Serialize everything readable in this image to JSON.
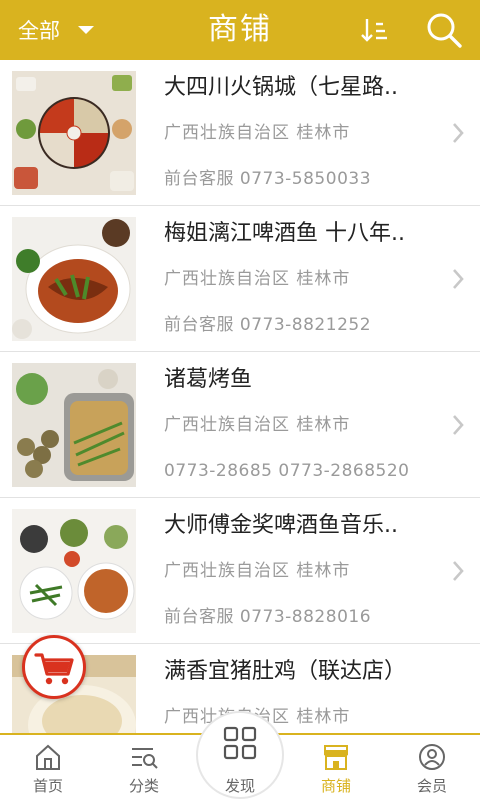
{
  "header": {
    "filter_label": "全部",
    "title": "商铺"
  },
  "stores": [
    {
      "name": "大四川火锅城（七星路..",
      "region": "广西壮族自治区 桂林市",
      "contact": "前台客服 0773-5850033"
    },
    {
      "name": "梅姐漓江啤酒鱼 十八年..",
      "region": "广西壮族自治区 桂林市",
      "contact": "前台客服 0773-8821252"
    },
    {
      "name": "诸葛烤鱼",
      "region": "广西壮族自治区 桂林市",
      "contact": "0773-28685 0773-2868520"
    },
    {
      "name": "大师傅金奖啤酒鱼音乐..",
      "region": "广西壮族自治区 桂林市",
      "contact": "前台客服 0773-8828016"
    },
    {
      "name": "满香宜猪肚鸡（联达店）",
      "region": "广西壮族自治区 桂林市",
      "contact": ""
    }
  ],
  "nav": {
    "home": "首页",
    "category": "分类",
    "discover": "发现",
    "stores": "商铺",
    "member": "会员"
  },
  "colors": {
    "brand": "#d9b31f",
    "cart_accent": "#d9321f"
  },
  "icons": [
    "chevron-down-icon",
    "sort-icon",
    "search-icon",
    "chevron-right-icon",
    "cart-icon",
    "home-icon",
    "category-icon",
    "discover-icon",
    "store-icon",
    "member-icon"
  ]
}
